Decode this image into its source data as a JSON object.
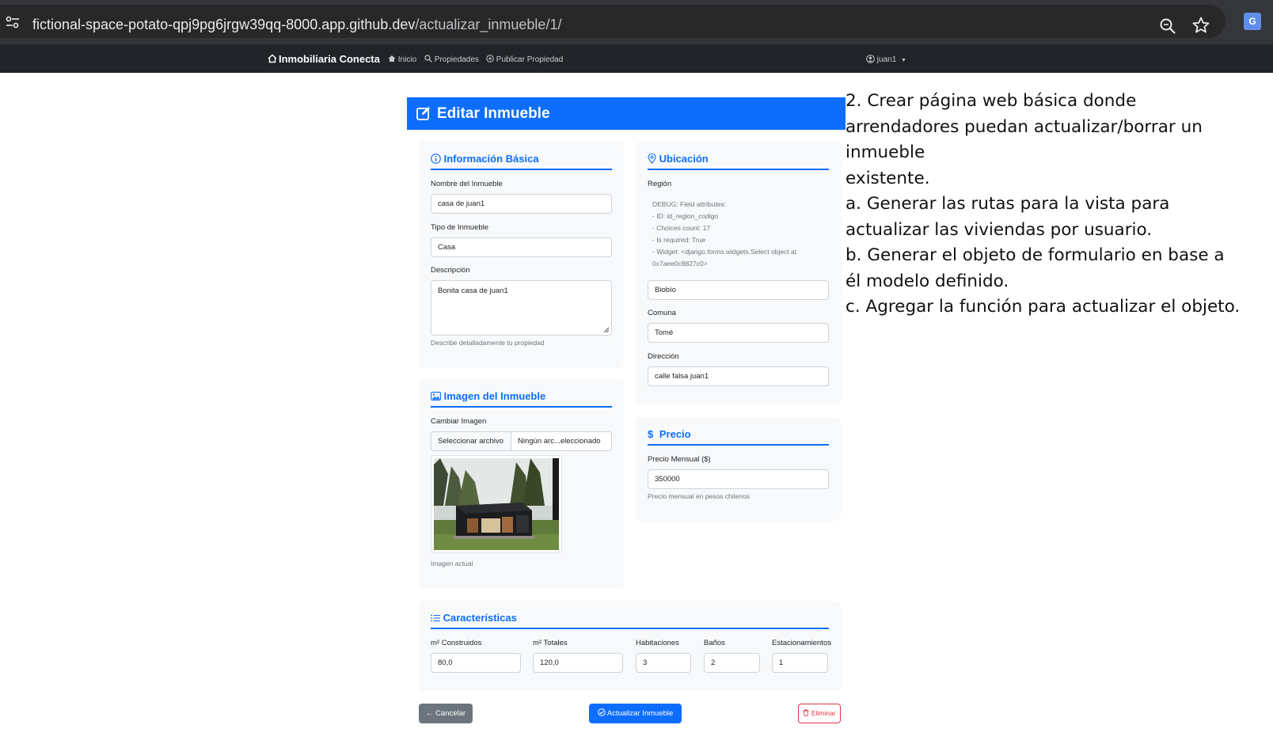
{
  "browser": {
    "url_host": "fictional-space-potato-qpj9pg6jrgw39qq-8000.app.github.dev",
    "url_path": "/actualizar_inmueble/1/"
  },
  "navbar": {
    "brand": "Inmobiliaria Conecta",
    "links": [
      "Inicio",
      "Propiedades",
      "Publicar Propiedad"
    ],
    "user": "juan1"
  },
  "page": {
    "title": "Editar Inmueble"
  },
  "basic_info": {
    "title": "Información Básica",
    "name_label": "Nombre del Inmueble",
    "name_value": "casa de juan1",
    "type_label": "Tipo de Inmueble",
    "type_value": "Casa",
    "desc_label": "Descripción",
    "desc_value": "Bonita casa de juan1",
    "desc_help": "Describe detalladamente tu propiedad"
  },
  "location": {
    "title": "Ubicación",
    "region_label": "Región",
    "debug_lines": [
      "DEBUG: Field attributes:",
      "- ID: id_region_codigo",
      "- Choices count: 17",
      "- Is required: True",
      "- Widget: <django.forms.widgets.Select object at",
      "0x7aee0c8827c0>"
    ],
    "region_value": "Biobío",
    "comuna_label": "Comuna",
    "comuna_value": "Tomé",
    "address_label": "Dirección",
    "address_value": "calle falsa juan1"
  },
  "image": {
    "title": "Imagen del Inmueble",
    "change_label": "Cambiar Imagen",
    "file_button": "Seleccionar archivo",
    "file_name": "Ningún arc...eleccionado",
    "current_caption": "Imagen actual"
  },
  "price": {
    "title": "Precio",
    "label": "Precio Mensual ($)",
    "value": "350000",
    "help": "Precio mensual en pesos chilenos"
  },
  "features": {
    "title": "Características",
    "fields": [
      {
        "label": "m² Construidos",
        "value": "80,0"
      },
      {
        "label": "m² Totales",
        "value": "120,0"
      },
      {
        "label": "Habitaciones",
        "value": "3"
      },
      {
        "label": "Baños",
        "value": "2"
      },
      {
        "label": "Estacionamientos",
        "value": "1"
      }
    ]
  },
  "actions": {
    "cancel": "Cancelar",
    "update": "Actualizar Inmueble",
    "delete": "Eliminar"
  },
  "note": {
    "lines": [
      "2. Crear página web básica donde",
      "arrendadores puedan actualizar/borrar un",
      "inmueble",
      "existente.",
      "a. Generar las rutas para la vista para",
      "actualizar las viviendas por usuario.",
      "b. Generar el objeto de formulario en base a",
      "él modelo definido.",
      "c. Agregar la función para actualizar el objeto."
    ]
  },
  "colors": {
    "primary": "#0d6efd",
    "danger": "#dc3545",
    "secondary": "#6c757d",
    "navbar": "#212529"
  }
}
